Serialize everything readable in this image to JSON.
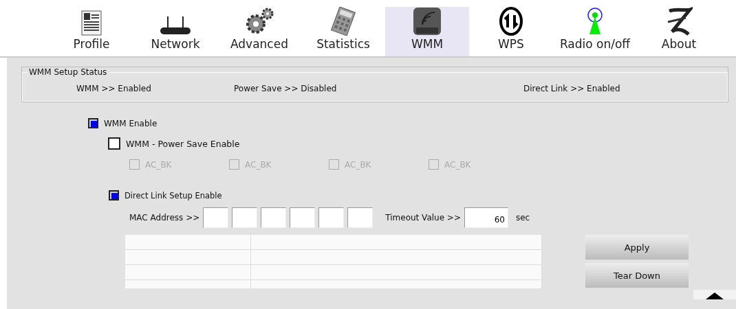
{
  "toolbar": {
    "tabs": [
      {
        "label": "Profile",
        "kind": "profile",
        "selected": false
      },
      {
        "label": "Network",
        "kind": "network",
        "selected": false
      },
      {
        "label": "Advanced",
        "kind": "advanced",
        "selected": false
      },
      {
        "label": "Statistics",
        "kind": "statistics",
        "selected": false
      },
      {
        "label": "WMM",
        "kind": "wmm",
        "selected": true
      },
      {
        "label": "WPS",
        "kind": "wps",
        "selected": false
      },
      {
        "label": "Radio on/off",
        "kind": "radio",
        "selected": false
      },
      {
        "label": "About",
        "kind": "about",
        "selected": false
      }
    ]
  },
  "status_box": {
    "title": "WMM Setup Status",
    "items": [
      "WMM >> Enabled",
      "Power Save >> Disabled",
      "Direct Link >> Enabled"
    ]
  },
  "wmm_enable": {
    "label": "WMM Enable",
    "checked": true
  },
  "power_save": {
    "label": "WMM - Power Save Enable",
    "checked": false
  },
  "ac_options": [
    {
      "label": "AC_BK",
      "checked": false,
      "disabled": true
    },
    {
      "label": "AC_BK",
      "checked": false,
      "disabled": true
    },
    {
      "label": "AC_BK",
      "checked": false,
      "disabled": true
    },
    {
      "label": "AC_BK",
      "checked": false,
      "disabled": true
    }
  ],
  "direct_link": {
    "label": "Direct Link Setup Enable",
    "checked": true
  },
  "mac": {
    "label": "MAC Address >>"
  },
  "timeout": {
    "label": "Timeout Value >>",
    "value": "60",
    "unit": "sec"
  },
  "buttons": [
    "Apply",
    "Tear Down"
  ]
}
